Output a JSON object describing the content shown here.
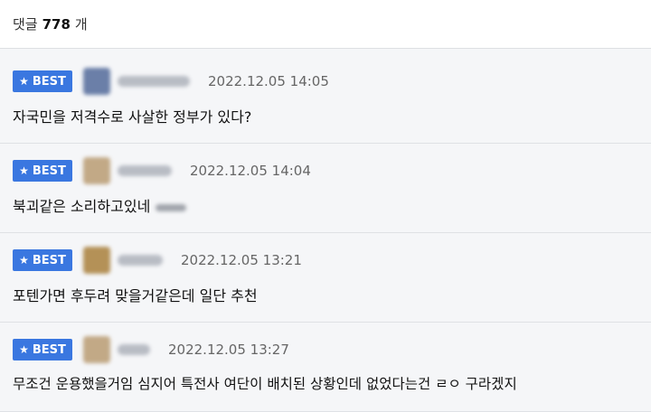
{
  "header": {
    "label": "댓글",
    "count": "778",
    "unit": "개"
  },
  "comments": [
    {
      "badge": "BEST",
      "date": "2022.12.05 14:05",
      "text": "자국민을 저격수로 사살한 정부가 있다?",
      "avatar_color": "#6b7fa8",
      "emote": ""
    },
    {
      "badge": "BEST",
      "date": "2022.12.05 14:04",
      "text": "북괴같은 소리하고있네",
      "avatar_color": "#c2a986",
      "emote": "blurred"
    },
    {
      "badge": "BEST",
      "date": "2022.12.05 13:21",
      "text": "포텐가면 후두려 맞을거같은데 일단 추천",
      "avatar_color": "#b49157",
      "emote": ""
    },
    {
      "badge": "BEST",
      "date": "2022.12.05 13:27",
      "text": "무조건 운용했을거임 심지어 특전사 여단이 배치된 상황인데 없었다는건 ㄹㅇ 구라겠지",
      "avatar_color": "#c2a986",
      "emote": ""
    }
  ],
  "colors": {
    "badge": "#3a77e0",
    "background": "#f5f6f8"
  }
}
